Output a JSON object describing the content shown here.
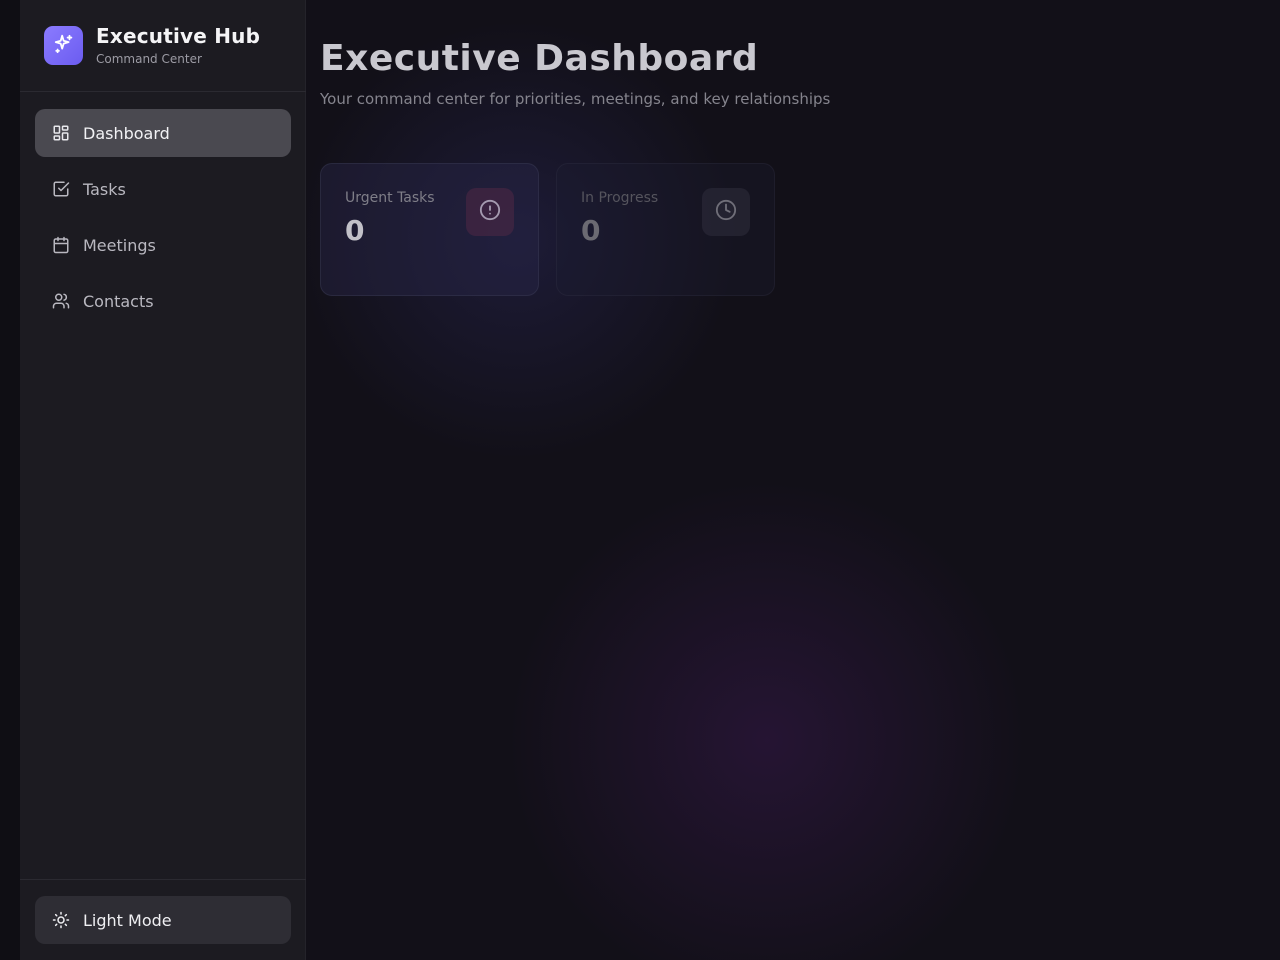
{
  "sidebar": {
    "brand": {
      "title": "Executive Hub",
      "subtitle": "Command Center",
      "logo_icon": "sparkles-icon",
      "accent": "#7c6cf7"
    },
    "items": [
      {
        "label": "Dashboard",
        "icon": "layout-grid-icon",
        "active": true
      },
      {
        "label": "Tasks",
        "icon": "check-square-icon",
        "active": false
      },
      {
        "label": "Meetings",
        "icon": "calendar-icon",
        "active": false
      },
      {
        "label": "Contacts",
        "icon": "users-icon",
        "active": false
      }
    ],
    "footer": {
      "theme_toggle_label": "Light Mode",
      "theme_toggle_icon": "sun-icon"
    }
  },
  "main": {
    "title": "Executive Dashboard",
    "subtitle": "Your command center for priorities, meetings, and key relationships",
    "stats": [
      {
        "label": "Urgent Tasks",
        "value": "0",
        "icon": "alert-circle-icon",
        "color": "#b8a7c4"
      },
      {
        "label": "In Progress",
        "value": "0",
        "icon": "clock-icon",
        "color": "#8a8995"
      }
    ]
  }
}
